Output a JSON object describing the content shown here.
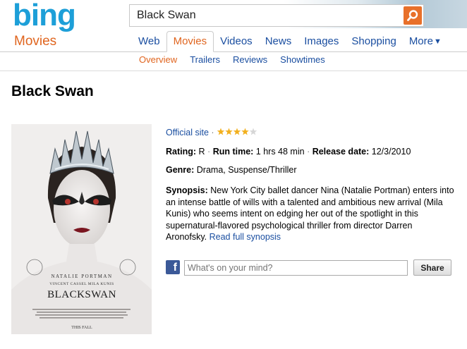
{
  "header": {
    "logo_text": "bing",
    "vertical_title": "Movies",
    "search_value": "Black Swan",
    "tabs": [
      {
        "label": "Web"
      },
      {
        "label": "Movies",
        "active": true
      },
      {
        "label": "Videos"
      },
      {
        "label": "News"
      },
      {
        "label": "Images"
      },
      {
        "label": "Shopping"
      },
      {
        "label": "More"
      }
    ],
    "subtabs": [
      {
        "label": "Overview",
        "active": true
      },
      {
        "label": "Trailers"
      },
      {
        "label": "Reviews"
      },
      {
        "label": "Showtimes"
      }
    ],
    "colors": {
      "accent": "#e0651f",
      "link": "#1a4ea0",
      "logo": "#1d9fd8"
    }
  },
  "movie": {
    "title": "Black Swan",
    "poster": {
      "credits_line1": "NATALIE PORTMAN",
      "credits_line2": "VINCENT CASSEL  MILA KUNIS",
      "title_text": "BLACKSWAN",
      "footer_text": "THIS FALL"
    },
    "official_site_label": "Official site",
    "rating_stars": 4,
    "rating_max": 5,
    "rating_label": "Rating:",
    "rating_value": "R",
    "runtime_label": "Run time:",
    "runtime_value": "1 hrs 48 min",
    "release_label": "Release date:",
    "release_value": "12/3/2010",
    "genre_label": "Genre:",
    "genre_value": "Drama, Suspense/Thriller",
    "synopsis_label": "Synopsis:",
    "synopsis_text": "New York City ballet dancer Nina (Natalie Portman) enters into an intense battle of wills with a talented and ambitious new arrival (Mila Kunis) who seems intent on edging her out of the spotlight in this supernatural-flavored psychological thriller from director Darren Aronofsky.",
    "read_more_label": "Read full synopsis"
  },
  "share": {
    "placeholder": "What's on your mind?",
    "button_label": "Share"
  }
}
